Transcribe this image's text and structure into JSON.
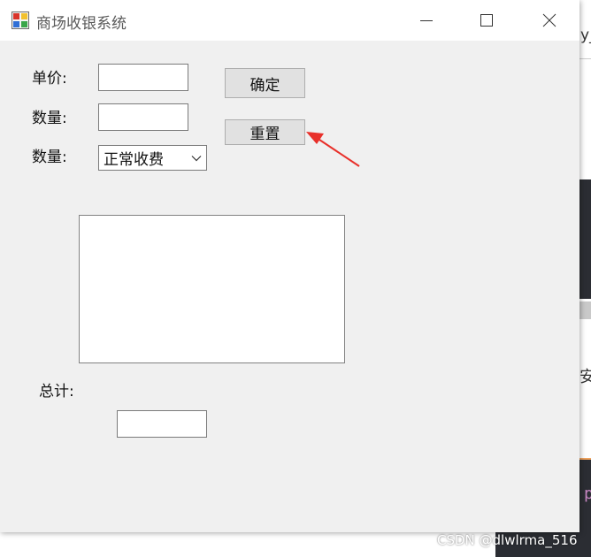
{
  "window": {
    "title": "商场收银系统",
    "controls": [
      "minimize-icon",
      "maximize-icon",
      "close-icon"
    ]
  },
  "form": {
    "price_label": "单价:",
    "price_value": "",
    "quantity_label": "数量:",
    "quantity_value": "",
    "mode_label": "数量:",
    "mode_selected": "正常收费",
    "confirm_button": "确定",
    "reset_button": "重置",
    "list_items": [],
    "total_label": "总计:",
    "total_value": ""
  },
  "background": {
    "fragment_top": "y_",
    "fragment_mid": "安",
    "fragment_code": "p"
  },
  "watermark": "CSDN @dlwlrma_516",
  "colors": {
    "window_bg": "#f0f0f0",
    "titlebar_bg": "#ffffff",
    "button_bg": "#e1e1e1",
    "annotation_arrow": "#e8302a"
  }
}
